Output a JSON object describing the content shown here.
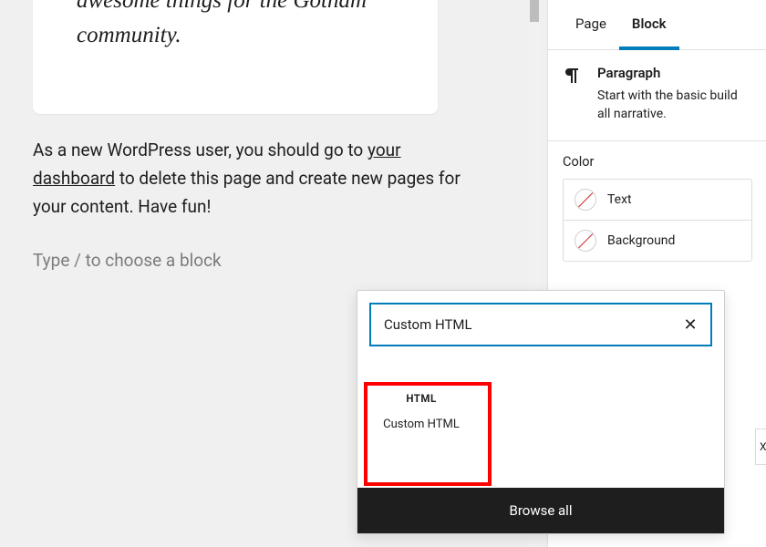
{
  "editor": {
    "quote_text": "awesome things for the Gotham community.",
    "para_pre": "As a new WordPress user, you should go to ",
    "para_link": "your dashboard",
    "para_post": " to delete this page and create new pages for your content. Have fun!",
    "placeholder": "Type / to choose a block"
  },
  "sidebar": {
    "tab_page": "Page",
    "tab_block": "Block",
    "block_title": "Paragraph",
    "block_desc": "Start with the basic build all narrative.",
    "color_heading": "Color",
    "color_text": "Text",
    "color_background": "Background",
    "typo_frag": "Xl"
  },
  "inserter": {
    "search_value": "Custom HTML",
    "clear_glyph": "✕",
    "result_icon_label": "HTML",
    "result_label": "Custom HTML",
    "browse_all": "Browse all"
  }
}
